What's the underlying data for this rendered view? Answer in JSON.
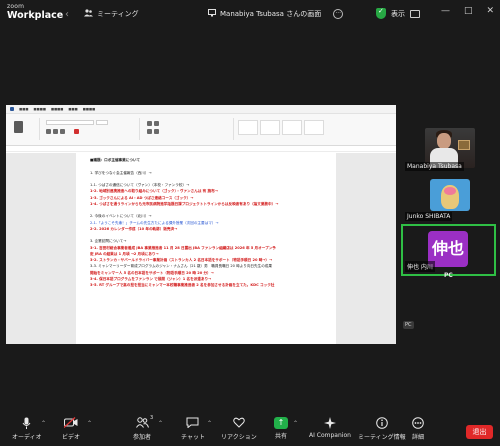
{
  "app": {
    "logo_line1": "zoom",
    "logo_line2": "Workplace"
  },
  "titlebar": {
    "nav_back": "‹",
    "nav_forward": "›",
    "meeting_tab_icon": "people-icon",
    "meeting_tab": "ミーティング",
    "share_title": "Manabiya Tsubasa さんの画面",
    "more": "···",
    "view_label": "表示",
    "win_controls": [
      "—",
      "□",
      "✕"
    ]
  },
  "document": {
    "lines": [
      {
        "text": "■議題：ロボ主催事業について",
        "style": "bold"
      },
      {
        "text": ""
      },
      {
        "text": "1. 学びをつなぐ会主催報告（西川）→",
        "style": ""
      },
      {
        "text": ""
      },
      {
        "text": "1-1. つばさの通信について（ヴァン）（本校・ファンラ校）→",
        "style": ""
      },
      {
        "text": "1-2. 地域別連携推進への取り組みについて（ゴック）・ヴァンさんは 有 施布→",
        "style": "red"
      },
      {
        "text": "1-3. ゴックさんによる AI・AD つばさ連絡コース（ゴック）→",
        "style": "red"
      },
      {
        "text": "1-4. つばさを通うラインからも元市民病院進学話題日課プロジェクトトラインからは反映者有あり（論文業務中）→",
        "style": "red"
      },
      {
        "text": ""
      },
      {
        "text": "2. 今後のイベントについて（北川）→",
        "style": ""
      },
      {
        "text": "2-1.「ようこそ先輩！」チームの先生方たによる課外授業（次回の主要はマ）→",
        "style": "blue"
      },
      {
        "text": "2-2. 2026 カレンダー作成（10 年の軌跡）販売済→",
        "style": "red"
      },
      {
        "text": ""
      },
      {
        "text": "3. 企業訪問について→",
        "style": ""
      },
      {
        "text": "3-1. 吉田村総合事業者養成 JBA 事業推進者 11 月 28 日露出 JBA ファンラン組織店は 2026 年 5 月オープン予",
        "style": "red"
      },
      {
        "text": "定 JRA の結果は 1 月頃 →2 月頃にあり→",
        "style": "red"
      },
      {
        "text": "3-2. ストランカ・サバールドライバー事業計画（ストランカ人 2 名日本語をサポート（物語手順日 20 時→）→",
        "style": "red"
      },
      {
        "text": "3-3. ミャンマーリーダー育成プログラムのジャン・ナムさん（21 歳）男　職員長職日 20 時より向日先生の成果",
        "style": ""
      },
      {
        "text": "開始をミャンマー人 5 名の日本語をサポート（物語手順日 20 時 20 分）→",
        "style": "red"
      },
      {
        "text": "3-4. 保日本語プログラムをファンラン で展開（ジャン）1 名を派遣あり→",
        "style": "red"
      },
      {
        "text": "3-5. RT グループで高の担を担当にミャンマー本校職事業推進者 2 名を参加させる計画を立てた。KDC コック社",
        "style": "red"
      }
    ]
  },
  "participants": [
    {
      "name": "Manabiya Tsubasa"
    },
    {
      "name": "Junko SHIBATA"
    },
    {
      "name": "伸也 内川",
      "avatar_text": "伸也"
    }
  ],
  "pc_label": "PC",
  "pc_chip": "PC",
  "toolbar": {
    "audio": "オーディオ",
    "audio_icon": "microphone-icon",
    "video": "ビデオ",
    "video_icon": "camera-icon",
    "participants": "参加者",
    "participants_count": "3",
    "participants_icon": "people-icon",
    "chat": "チャット",
    "chat_icon": "chat-bubble-icon",
    "reactions": "リアクション",
    "reactions_icon": "heart-icon",
    "share": "共有",
    "share_icon": "share-screen-icon",
    "ai": "AI Companion",
    "ai_icon": "sparkle-icon",
    "meeting_info": "ミーティング情報",
    "meeting_info_icon": "info-icon",
    "more": "詳細",
    "more_icon": "more-icon",
    "end": "退出"
  },
  "colors": {
    "share_green": "#22b04a",
    "end_red": "#e02828",
    "active_speaker": "#2fbf45",
    "avatar_purple": "#9b2fc4"
  }
}
